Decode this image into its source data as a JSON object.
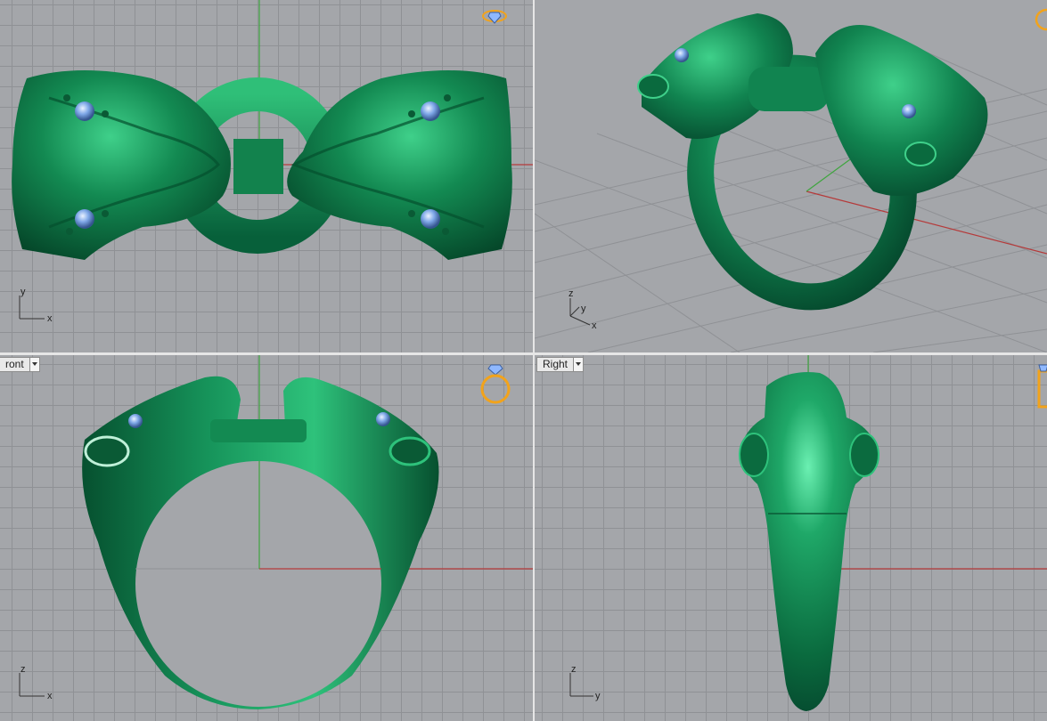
{
  "viewports": {
    "top": {
      "label": "",
      "axes": {
        "h": "x",
        "v": "y"
      }
    },
    "perspective": {
      "label": "",
      "axes": {
        "a": "x",
        "b": "y",
        "c": "z"
      }
    },
    "front": {
      "label": "ront",
      "axes": {
        "h": "x",
        "v": "z"
      }
    },
    "right": {
      "label": "Right",
      "axes": {
        "h": "y",
        "v": "z"
      }
    }
  },
  "colors": {
    "viewport_bg": "#a4a6aa",
    "grid_line": "#8f9195",
    "x_axis": "#b53a3a",
    "y_axis": "#3fa53f",
    "model": "#0d7a4a",
    "model_highlight": "#3fd08a",
    "gem": "#7fa8e8",
    "ring_icon": "#f2a31b"
  },
  "icons": [
    "ring-gem-icon",
    "viewport-dropdown-icon"
  ]
}
